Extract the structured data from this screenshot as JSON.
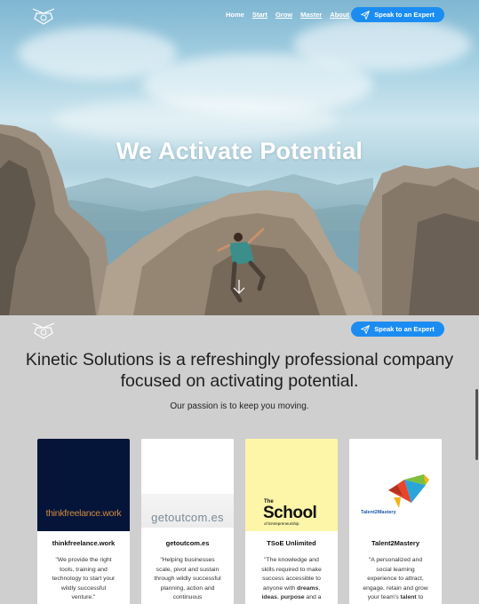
{
  "nav": {
    "items": [
      {
        "label": "Home"
      },
      {
        "label": "Start"
      },
      {
        "label": "Grow"
      },
      {
        "label": "Master"
      },
      {
        "label": "About"
      }
    ],
    "cta_label": "Speak to an Expert"
  },
  "hero": {
    "title": "We Activate Potential"
  },
  "section": {
    "cta_label": "Speak to an Expert",
    "tagline": "Kinetic Solutions is a refreshingly professional company focused on activating potential.",
    "passion": "Our passion is to keep you moving."
  },
  "cards": [
    {
      "logo_text": "thinkfreelance.work",
      "title": "thinkfreelance.work",
      "desc": "\"We provide the right tools, training and technology to start your wildly successful venture.\""
    },
    {
      "logo_text": "getoutcom.es",
      "title": "getoutcom.es",
      "desc": "\"Helping businesses scale, pivot and sustain through wildly successful planning, action and continuous"
    },
    {
      "logo_the": "The",
      "logo_school": "School",
      "logo_sub": "of Entrepreneurship",
      "title": "TSoE Unlimited",
      "desc_parts": [
        "\"The knowledge and skills required to make success accessible to anyone with ",
        "dreams",
        ", ",
        "ideas",
        ", ",
        "purpose",
        " and a"
      ]
    },
    {
      "logo_text": "Talent2Mastery",
      "title": "Talent2Mastery",
      "desc_parts": [
        "\"A personalized and social learning experience to attract, engage, retain and grow your team's ",
        "talent",
        " to"
      ]
    }
  ],
  "colors": {
    "accent": "#1b8df2",
    "section_bg": "#cfcfcf"
  }
}
